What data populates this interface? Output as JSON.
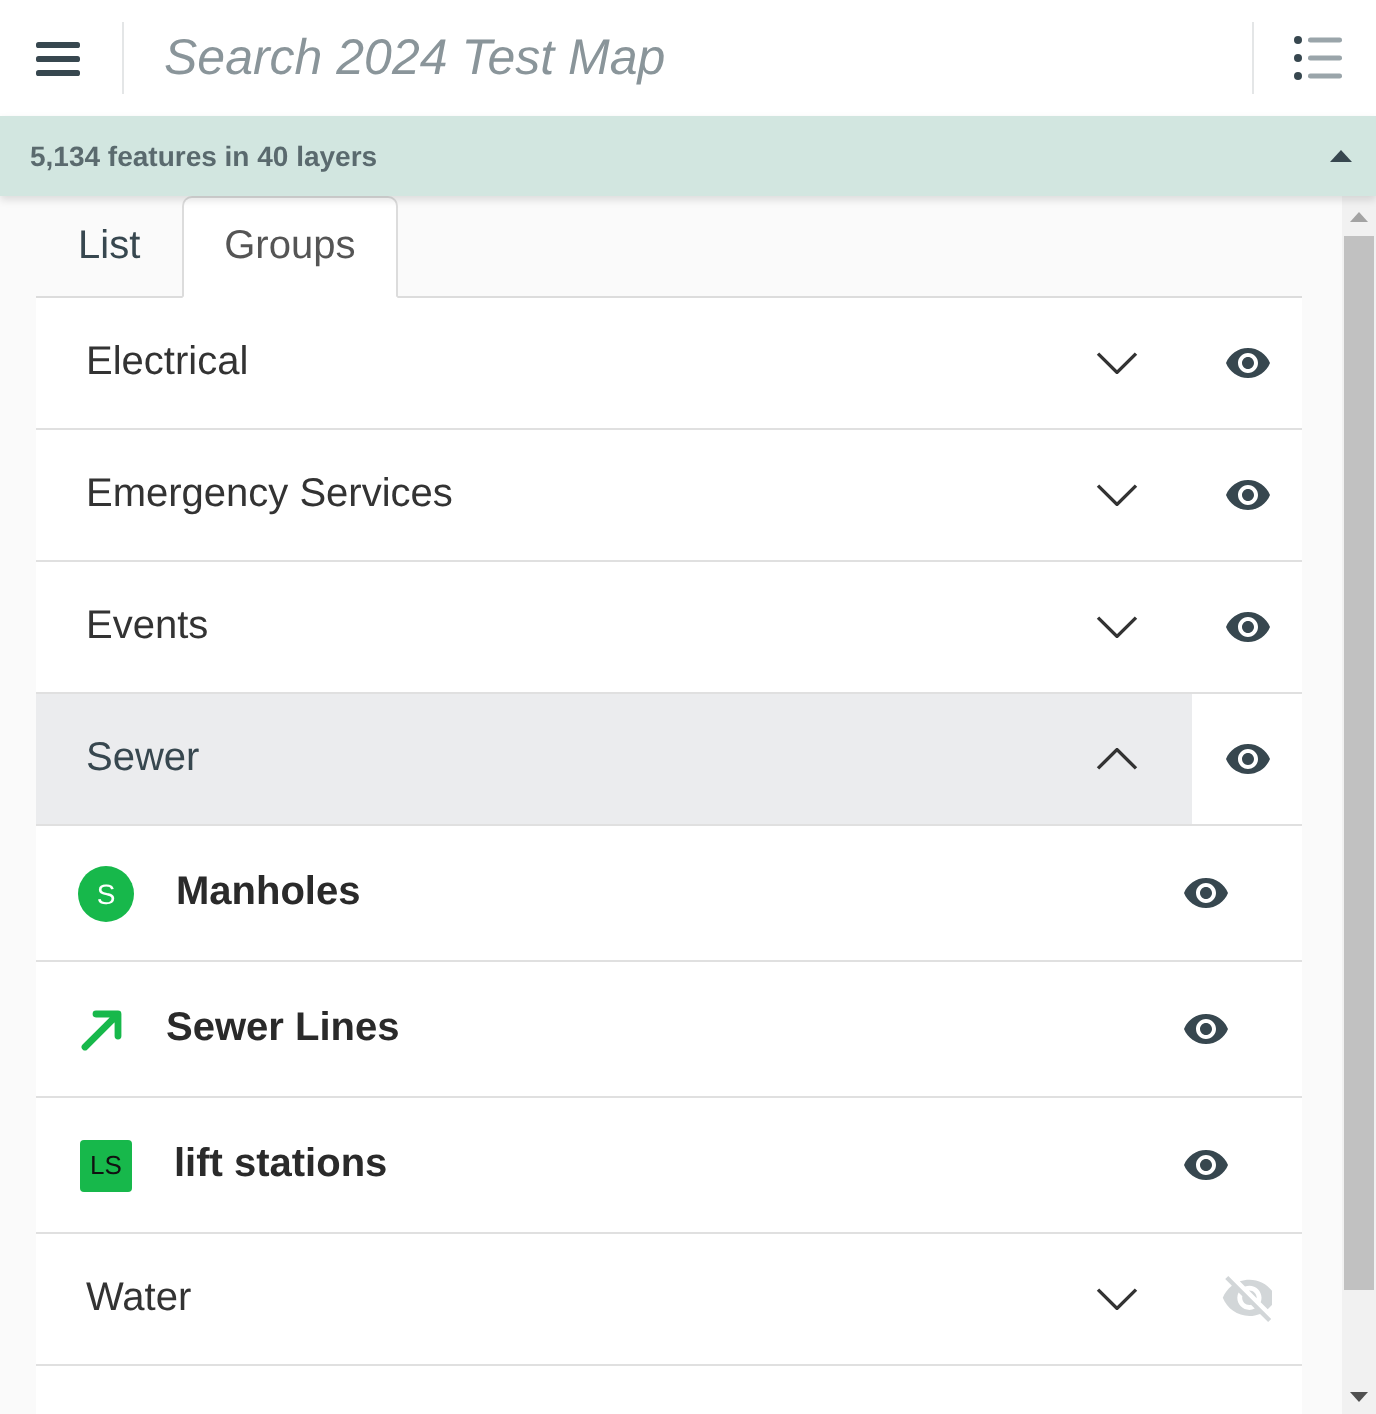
{
  "header": {
    "search": {
      "placeholder": "Search 2024 Test Map"
    }
  },
  "status_bar": {
    "text": "5,134 features in 40 layers"
  },
  "tabs": [
    {
      "label": "List",
      "selected": false
    },
    {
      "label": "Groups",
      "selected": true
    }
  ],
  "groups": [
    {
      "name": "Electrical",
      "expanded": false,
      "visible": true
    },
    {
      "name": "Emergency Services",
      "expanded": false,
      "visible": true
    },
    {
      "name": "Events",
      "expanded": false,
      "visible": true
    },
    {
      "name": "Sewer",
      "expanded": true,
      "visible": true,
      "layers": [
        {
          "name": "Manholes",
          "visible": true,
          "symbol": {
            "kind": "circle",
            "text": "S"
          }
        },
        {
          "name": "Sewer Lines",
          "visible": true,
          "symbol": {
            "kind": "arrow"
          }
        },
        {
          "name": "lift stations",
          "visible": true,
          "symbol": {
            "kind": "square",
            "text": "LS"
          }
        }
      ]
    },
    {
      "name": "Water",
      "expanded": false,
      "visible": false
    }
  ]
}
